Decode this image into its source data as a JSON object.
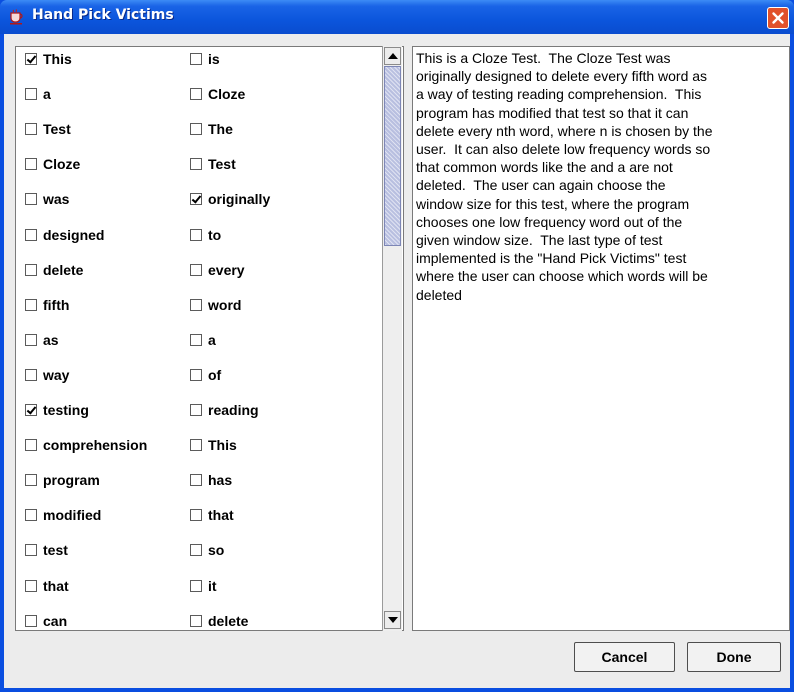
{
  "window": {
    "title": "Hand Pick Victims"
  },
  "words_left": [
    {
      "word": "This",
      "checked": true
    },
    {
      "word": "a",
      "checked": false
    },
    {
      "word": "Test",
      "checked": false
    },
    {
      "word": "Cloze",
      "checked": false
    },
    {
      "word": "was",
      "checked": false
    },
    {
      "word": "designed",
      "checked": false
    },
    {
      "word": "delete",
      "checked": false
    },
    {
      "word": "fifth",
      "checked": false
    },
    {
      "word": "as",
      "checked": false
    },
    {
      "word": "way",
      "checked": false
    },
    {
      "word": "testing",
      "checked": true
    },
    {
      "word": "comprehension",
      "checked": false
    },
    {
      "word": "program",
      "checked": false
    },
    {
      "word": "modified",
      "checked": false
    },
    {
      "word": "test",
      "checked": false
    },
    {
      "word": "that",
      "checked": false
    },
    {
      "word": "can",
      "checked": false
    }
  ],
  "words_right": [
    {
      "word": "is",
      "checked": false
    },
    {
      "word": "Cloze",
      "checked": false
    },
    {
      "word": "The",
      "checked": false
    },
    {
      "word": "Test",
      "checked": false
    },
    {
      "word": "originally",
      "checked": true
    },
    {
      "word": "to",
      "checked": false
    },
    {
      "word": "every",
      "checked": false
    },
    {
      "word": "word",
      "checked": false
    },
    {
      "word": "a",
      "checked": false
    },
    {
      "word": "of",
      "checked": false
    },
    {
      "word": "reading",
      "checked": false
    },
    {
      "word": "This",
      "checked": false
    },
    {
      "word": "has",
      "checked": false
    },
    {
      "word": "that",
      "checked": false
    },
    {
      "word": "so",
      "checked": false
    },
    {
      "word": "it",
      "checked": false
    },
    {
      "word": "delete",
      "checked": false
    }
  ],
  "text_lines": [
    "This is a Cloze Test.  The Cloze Test was",
    "originally designed to delete every fifth word as",
    "a way of testing reading comprehension.  This",
    "program has modified that test so that it can",
    "delete every nth word, where n is chosen by the",
    "user.  It can also delete low frequency words so",
    "that common words like the and a are not",
    "deleted.  The user can again choose the",
    "window size for this test, where the program",
    "chooses one low frequency word out of the",
    "given window size.  The last type of test",
    "implemented is the \"Hand Pick Victims\" test",
    "where the user can choose which words will be",
    "deleted"
  ],
  "buttons": {
    "cancel": "Cancel",
    "done": "Done"
  },
  "colors": {
    "title_bar": "#0b55dc",
    "close_button": "#e1512b",
    "client_bg": "#ececec",
    "scroll_thumb": "#b8bfe0"
  },
  "icons": {
    "app": "teacup-app-icon",
    "close": "close-icon",
    "scroll_up": "triangle-up-icon",
    "scroll_down": "triangle-down-icon"
  }
}
